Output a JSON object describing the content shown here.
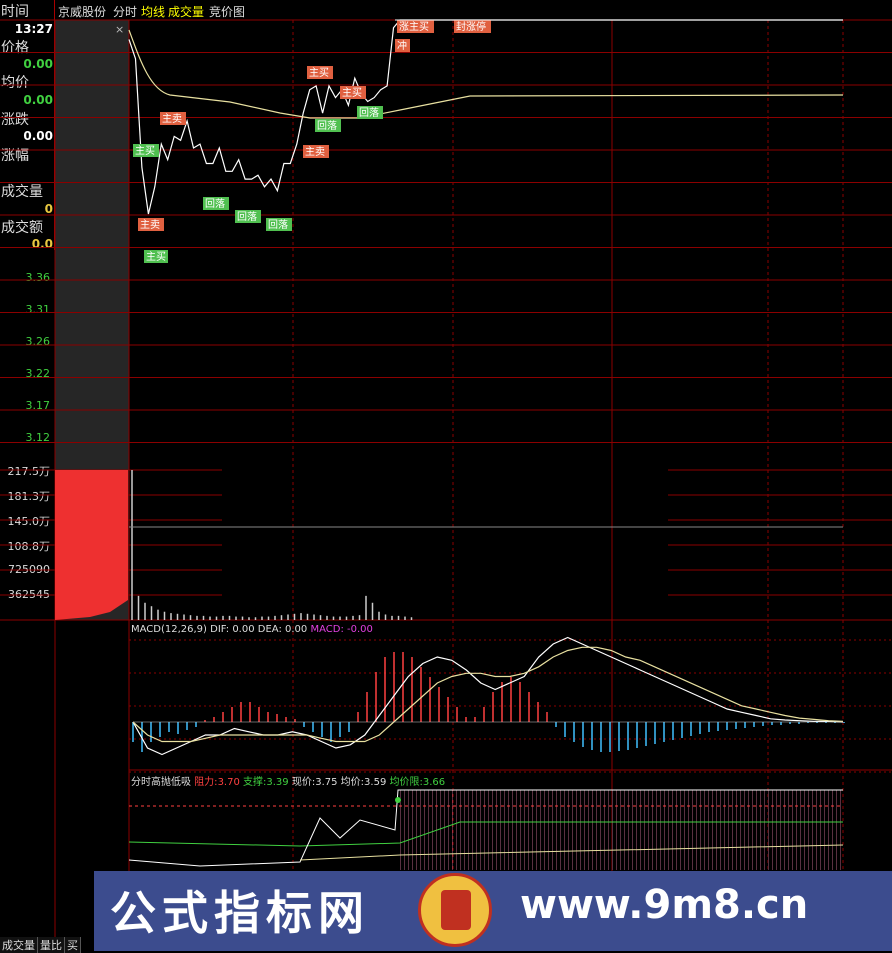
{
  "topbar": {
    "label": "时间",
    "stock_name": "京威股份",
    "tab_intraday": "分时",
    "tab_avg": "均线",
    "tab_volume": "成交量",
    "tab_auction": "竞价图"
  },
  "info_panel": {
    "time_value": "13:27",
    "price_label": "价格",
    "price_value": "0.00",
    "avg_label": "均价",
    "avg_value": "0.00",
    "change_label": "涨跌",
    "change_value": "0.00",
    "pct_label": "涨幅",
    "volume_label": "成交量",
    "volume_value": "0",
    "amount_label": "成交额",
    "amount_value": "0.0"
  },
  "price_axis": [
    "3.36",
    "3.31",
    "3.26",
    "3.22",
    "3.17",
    "3.12"
  ],
  "volume_axis": [
    "217.5万",
    "181.3万",
    "145.0万",
    "108.8万",
    "725090",
    "362545"
  ],
  "signals": [
    "主买",
    "主卖",
    "主卖",
    "回落",
    "回落",
    "回落",
    "主卖",
    "主买",
    "主买",
    "回落",
    "主买",
    "回落",
    "涨主买",
    "封涨停",
    "冲"
  ],
  "macd_legend": {
    "title": "MACD(12,26,9)",
    "dif": "DIF: 0.00",
    "dea": "DEA: 0.00",
    "macd": "MACD: -0.00"
  },
  "indicator_legend": {
    "title": "分时高抛低吸",
    "resistance_label": "阻力:",
    "resistance_value": "3.70",
    "support_label": "支撑:",
    "support_value": "3.39",
    "current_label": "现价:",
    "current_value": "3.75",
    "avg_label": "均价:",
    "avg_value": "3.59",
    "avg_limit_label": "均价限:",
    "avg_limit_value": "3.66"
  },
  "watermark": {
    "left_text": "公式指标网",
    "right_text": "www.9m8.cn"
  },
  "bottom_tabs": [
    "成交量",
    "量比",
    "买"
  ],
  "colors": {
    "grid": "#8b0000",
    "price_line": "#ffffff",
    "avg_line": "#e8e0a0",
    "up": "#ff4040",
    "down": "#40c0ff",
    "green_text": "#40d040",
    "buy_tag": "#e06040",
    "fall_tag": "#50c050"
  },
  "chart_data": {
    "type": "line",
    "price_series": [
      3.65,
      3.6,
      3.32,
      3.2,
      3.27,
      3.38,
      3.34,
      3.4,
      3.39,
      3.44,
      3.37,
      3.38,
      3.33,
      3.33,
      3.37,
      3.31,
      3.31,
      3.34,
      3.29,
      3.29,
      3.3,
      3.27,
      3.29,
      3.26,
      3.33,
      3.33,
      3.38,
      3.46,
      3.52,
      3.53,
      3.46,
      3.53,
      3.5,
      3.52,
      3.48,
      3.55,
      3.51,
      3.49,
      3.5,
      3.52,
      3.53,
      3.68,
      3.7,
      3.7,
      3.7,
      3.7,
      3.7,
      3.7,
      3.7,
      3.7,
      3.7,
      3.7,
      3.7,
      3.7,
      3.7,
      3.7,
      3.7,
      3.7,
      3.7,
      3.7
    ],
    "volume_series": [
      2175000,
      350000,
      250000,
      200000,
      150000,
      120000,
      100000,
      90000,
      80000,
      70000,
      60000,
      60000,
      50000,
      50000,
      60000,
      60000,
      50000,
      50000,
      40000,
      40000,
      50000,
      50000,
      60000,
      70000,
      80000,
      90000,
      100000,
      90000,
      80000,
      70000,
      60000,
      50000,
      50000,
      50000,
      60000,
      70000,
      350000,
      250000,
      120000,
      80000,
      60000,
      60000,
      50000,
      40000
    ],
    "volume_ylim": [
      0,
      2175000
    ],
    "price_ylim": [
      3.12,
      3.7
    ],
    "macd_bars": [
      -0.02,
      -0.03,
      -0.02,
      -0.015,
      -0.01,
      -0.012,
      -0.008,
      -0.005,
      0.002,
      0.005,
      0.01,
      0.015,
      0.02,
      0.02,
      0.015,
      0.01,
      0.008,
      0.005,
      0.003,
      -0.005,
      -0.01,
      -0.015,
      -0.02,
      -0.015,
      -0.01,
      0.01,
      0.03,
      0.05,
      0.065,
      0.07,
      0.07,
      0.065,
      0.055,
      0.045,
      0.035,
      0.025,
      0.015,
      0.005,
      0.005,
      0.015,
      0.03,
      0.04,
      0.045,
      0.04,
      0.03,
      0.02,
      0.01,
      -0.005,
      -0.015,
      -0.02,
      -0.025,
      -0.028,
      -0.03,
      -0.03,
      -0.029,
      -0.028,
      -0.026,
      -0.024,
      -0.022,
      -0.02,
      -0.018,
      -0.016,
      -0.014,
      -0.012,
      -0.01,
      -0.009,
      -0.008,
      -0.007,
      -0.006,
      -0.005,
      -0.004,
      -0.003,
      -0.003,
      -0.002,
      -0.002,
      -0.001,
      -0.001,
      -0.001,
      -0.001,
      -0.001
    ],
    "dif_series": [
      0.0,
      -0.04,
      -0.05,
      -0.04,
      -0.03,
      -0.02,
      -0.02,
      -0.01,
      -0.015,
      -0.02,
      -0.02,
      -0.015,
      -0.02,
      -0.03,
      -0.04,
      -0.035,
      -0.02,
      0.01,
      0.04,
      0.07,
      0.09,
      0.1,
      0.095,
      0.08,
      0.06,
      0.05,
      0.06,
      0.07,
      0.1,
      0.12,
      0.13,
      0.12,
      0.11,
      0.1,
      0.09,
      0.08,
      0.07,
      0.06,
      0.05,
      0.04,
      0.03,
      0.02,
      0.015,
      0.01,
      0.005,
      0.003,
      0.002,
      0.001,
      0.001,
      0.0
    ],
    "dea_series": [
      0.0,
      -0.02,
      -0.03,
      -0.03,
      -0.03,
      -0.025,
      -0.02,
      -0.02,
      -0.02,
      -0.02,
      -0.02,
      -0.02,
      -0.02,
      -0.025,
      -0.03,
      -0.03,
      -0.03,
      -0.02,
      0.0,
      0.02,
      0.04,
      0.06,
      0.07,
      0.075,
      0.075,
      0.07,
      0.07,
      0.075,
      0.085,
      0.1,
      0.11,
      0.115,
      0.115,
      0.11,
      0.1,
      0.095,
      0.085,
      0.075,
      0.065,
      0.055,
      0.045,
      0.035,
      0.025,
      0.02,
      0.015,
      0.01,
      0.006,
      0.004,
      0.002,
      0.001
    ]
  }
}
